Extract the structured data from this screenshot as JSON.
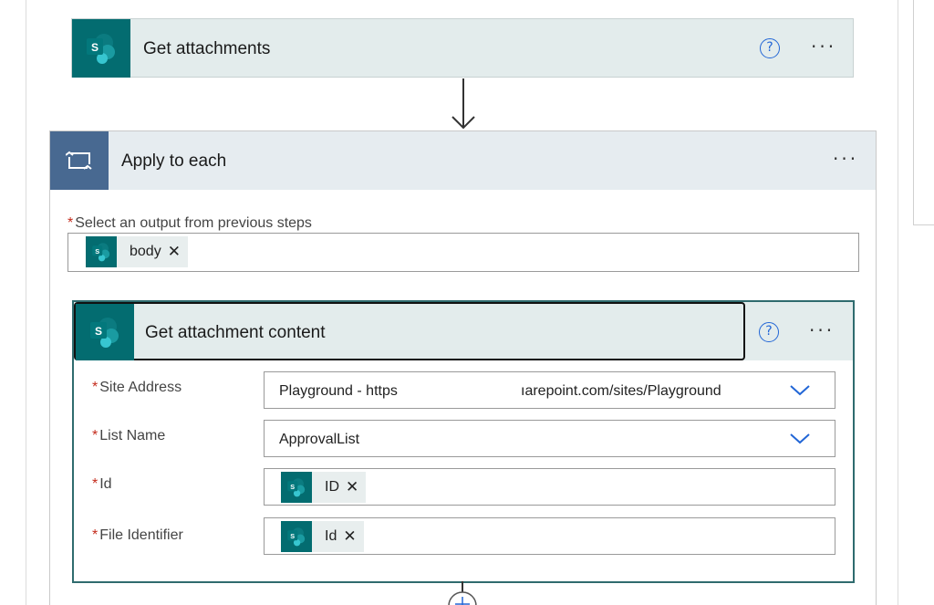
{
  "steps": {
    "get_attachments": {
      "title": "Get attachments"
    },
    "apply_each": {
      "title": "Apply to each",
      "output_label": "Select an output from previous steps",
      "output_token": "body"
    },
    "get_attachment_content": {
      "title": "Get attachment content",
      "fields": {
        "site_address": {
          "label": "Site Address",
          "value_left": "Playground - https",
          "value_right": "ıarepoint.com/sites/Playground"
        },
        "list_name": {
          "label": "List Name",
          "value": "ApprovalList"
        },
        "id": {
          "label": "Id",
          "token": "ID"
        },
        "file_identifier": {
          "label": "File Identifier",
          "token": "Id"
        }
      }
    }
  },
  "icons": {
    "help": "?",
    "more": "···",
    "remove": "✕",
    "required": "*"
  },
  "colors": {
    "sharepoint": "#036c70",
    "loop": "#486991",
    "accent": "#2266d6",
    "required": "#c42b1c"
  }
}
